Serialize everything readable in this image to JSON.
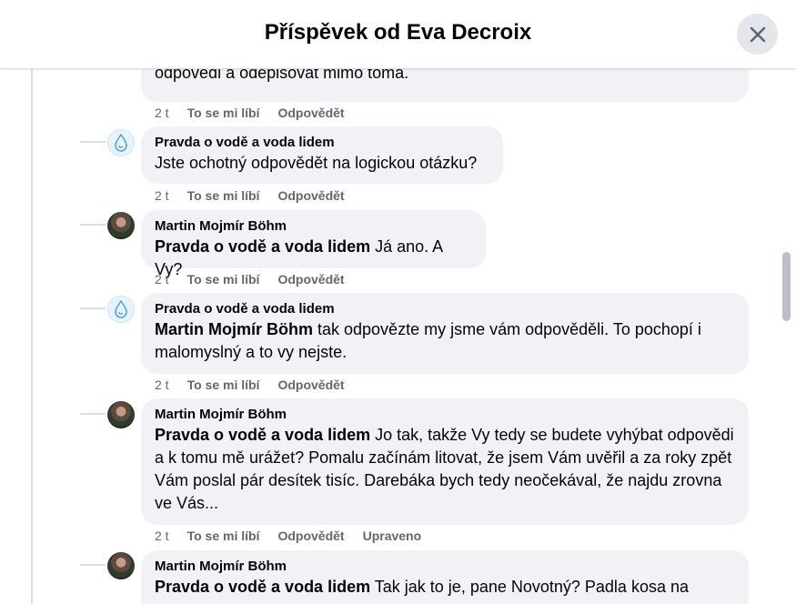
{
  "header": {
    "title": "Příspěvek od Eva Decroix"
  },
  "comments": [
    {
      "author": "",
      "tag": "",
      "text": "odpovědi a odepisovat mimo tóma.",
      "time": "2 t",
      "like": "To se mi líbí",
      "reply": "Odpovědět",
      "edited": ""
    },
    {
      "author": "Pravda o vodě a voda lidem",
      "tag": "",
      "text": "Jste ochotný odpovědět na logickou otázku?",
      "time": "2 t",
      "like": "To se mi líbí",
      "reply": "Odpovědět",
      "edited": ""
    },
    {
      "author": "Martin Mojmír Böhm",
      "tag": "Pravda o vodě a voda lidem",
      "text": " Já ano. A Vy?",
      "time": "2 t",
      "like": "To se mi líbí",
      "reply": "Odpovědět",
      "edited": ""
    },
    {
      "author": "Pravda o vodě a voda lidem",
      "tag": "Martin Mojmír Böhm",
      "text": " tak odpovězte my jsme vám odpověděli. To pochopí i malomyslný a to vy nejste.",
      "time": "2 t",
      "like": "To se mi líbí",
      "reply": "Odpovědět",
      "edited": ""
    },
    {
      "author": "Martin Mojmír Böhm",
      "tag": "Pravda o vodě a voda lidem",
      "text": " Jo tak, takže Vy tedy se budete vyhýbat odpovědi a k tomu mě urážet? Pomalu začínám litovat, že jsem Vám uvěřil a za roky zpět Vám poslal pár desítek tisíc. Darebáka bych tedy neočekával, že najdu zrovna ve Vás...",
      "time": "2 t",
      "like": "To se mi líbí",
      "reply": "Odpovědět",
      "edited": "Upraveno"
    },
    {
      "author": "Martin Mojmír Böhm",
      "tag": "Pravda o vodě a voda lidem",
      "text": " Tak jak to je, pane Novotný? Padla kosa na",
      "time": "",
      "like": "",
      "reply": "",
      "edited": ""
    }
  ]
}
